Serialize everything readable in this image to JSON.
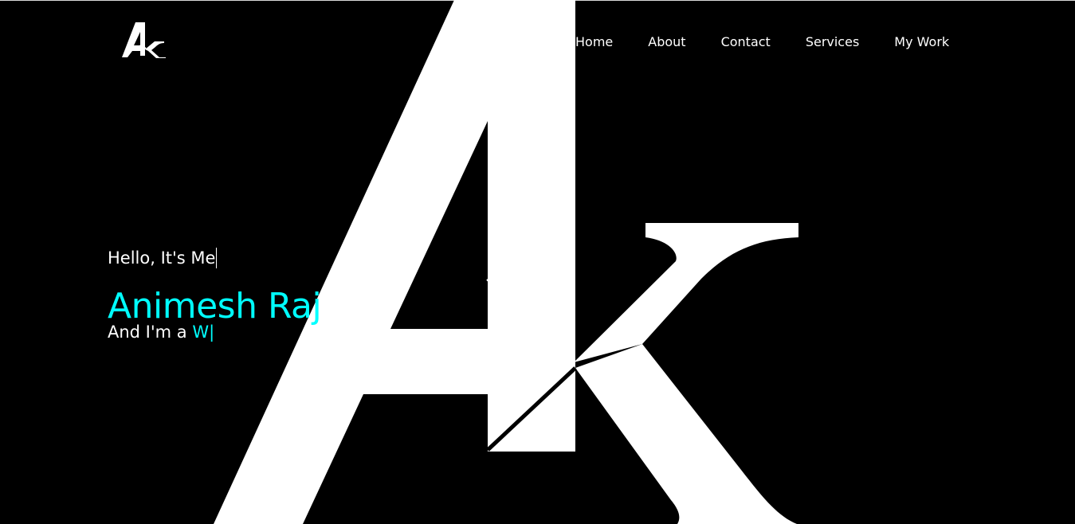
{
  "colors": {
    "background": "#000000",
    "foreground": "#ffffff",
    "accent": "#00ffff"
  },
  "header": {
    "logo_text": "AK",
    "nav": [
      {
        "label": "Home"
      },
      {
        "label": "About"
      },
      {
        "label": "Contact"
      },
      {
        "label": "Services"
      },
      {
        "label": "My Work"
      }
    ]
  },
  "hero": {
    "greeting": "Hello, It's Me",
    "name": "Animesh Raj",
    "role_prefix": "And I'm a",
    "role_typed": "W",
    "caret": "|",
    "background_monogram": "AK"
  }
}
